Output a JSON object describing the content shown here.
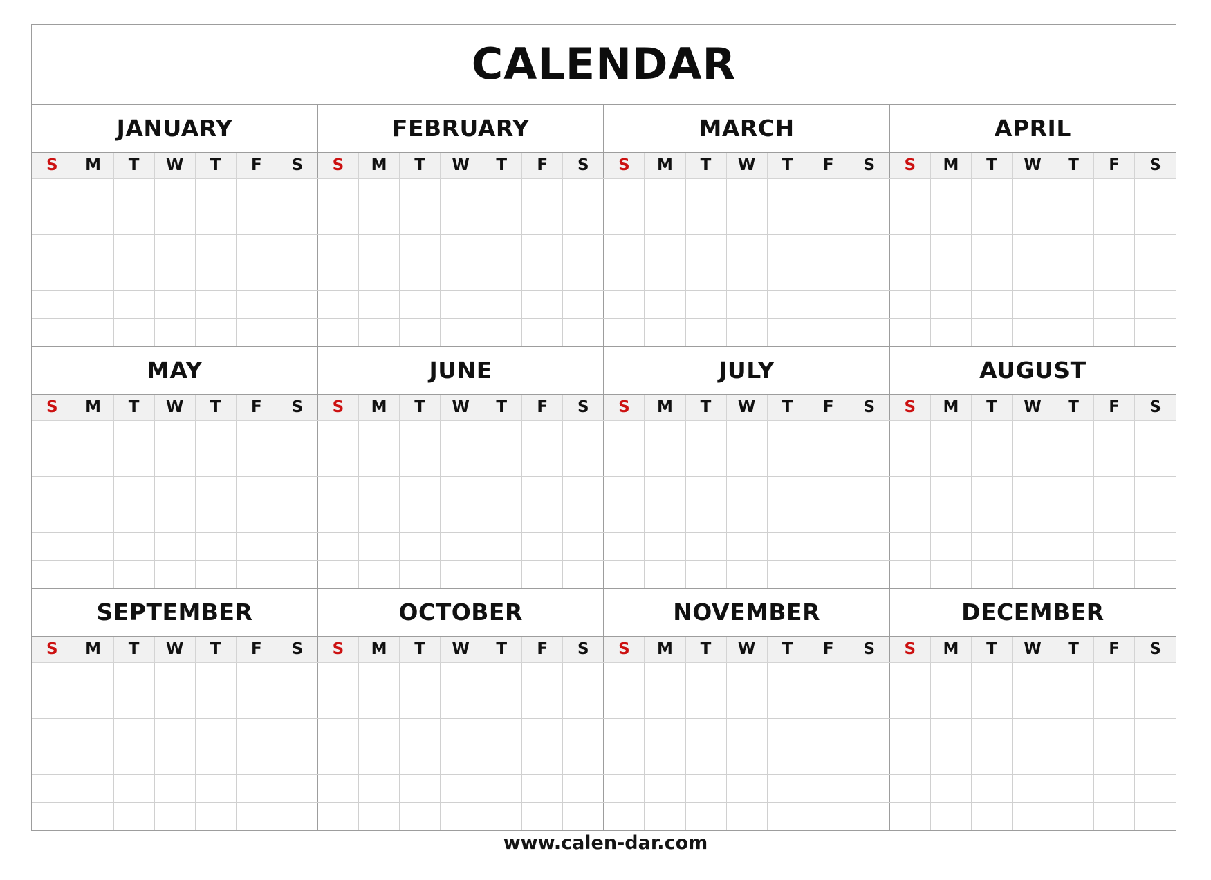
{
  "title": "CALENDAR",
  "footer": "www.calen-dar.com",
  "colors": {
    "sunday_text": "#cc1111",
    "dow_header_bg": "#f1f1f1",
    "grid_line": "#c2c2c2",
    "frame_line": "#9d9d9d",
    "text": "#111111"
  },
  "day_headers": [
    "S",
    "M",
    "T",
    "W",
    "T",
    "F",
    "S"
  ],
  "weeks_per_month": 6,
  "quarters": [
    {
      "months": [
        "JANUARY",
        "FEBRUARY",
        "MARCH",
        "APRIL"
      ]
    },
    {
      "months": [
        "MAY",
        "JUNE",
        "JULY",
        "AUGUST"
      ]
    },
    {
      "months": [
        "SEPTEMBER",
        "OCTOBER",
        "NOVEMBER",
        "DECEMBER"
      ]
    }
  ],
  "months": [
    "JANUARY",
    "FEBRUARY",
    "MARCH",
    "APRIL",
    "MAY",
    "JUNE",
    "JULY",
    "AUGUST",
    "SEPTEMBER",
    "OCTOBER",
    "NOVEMBER",
    "DECEMBER"
  ]
}
